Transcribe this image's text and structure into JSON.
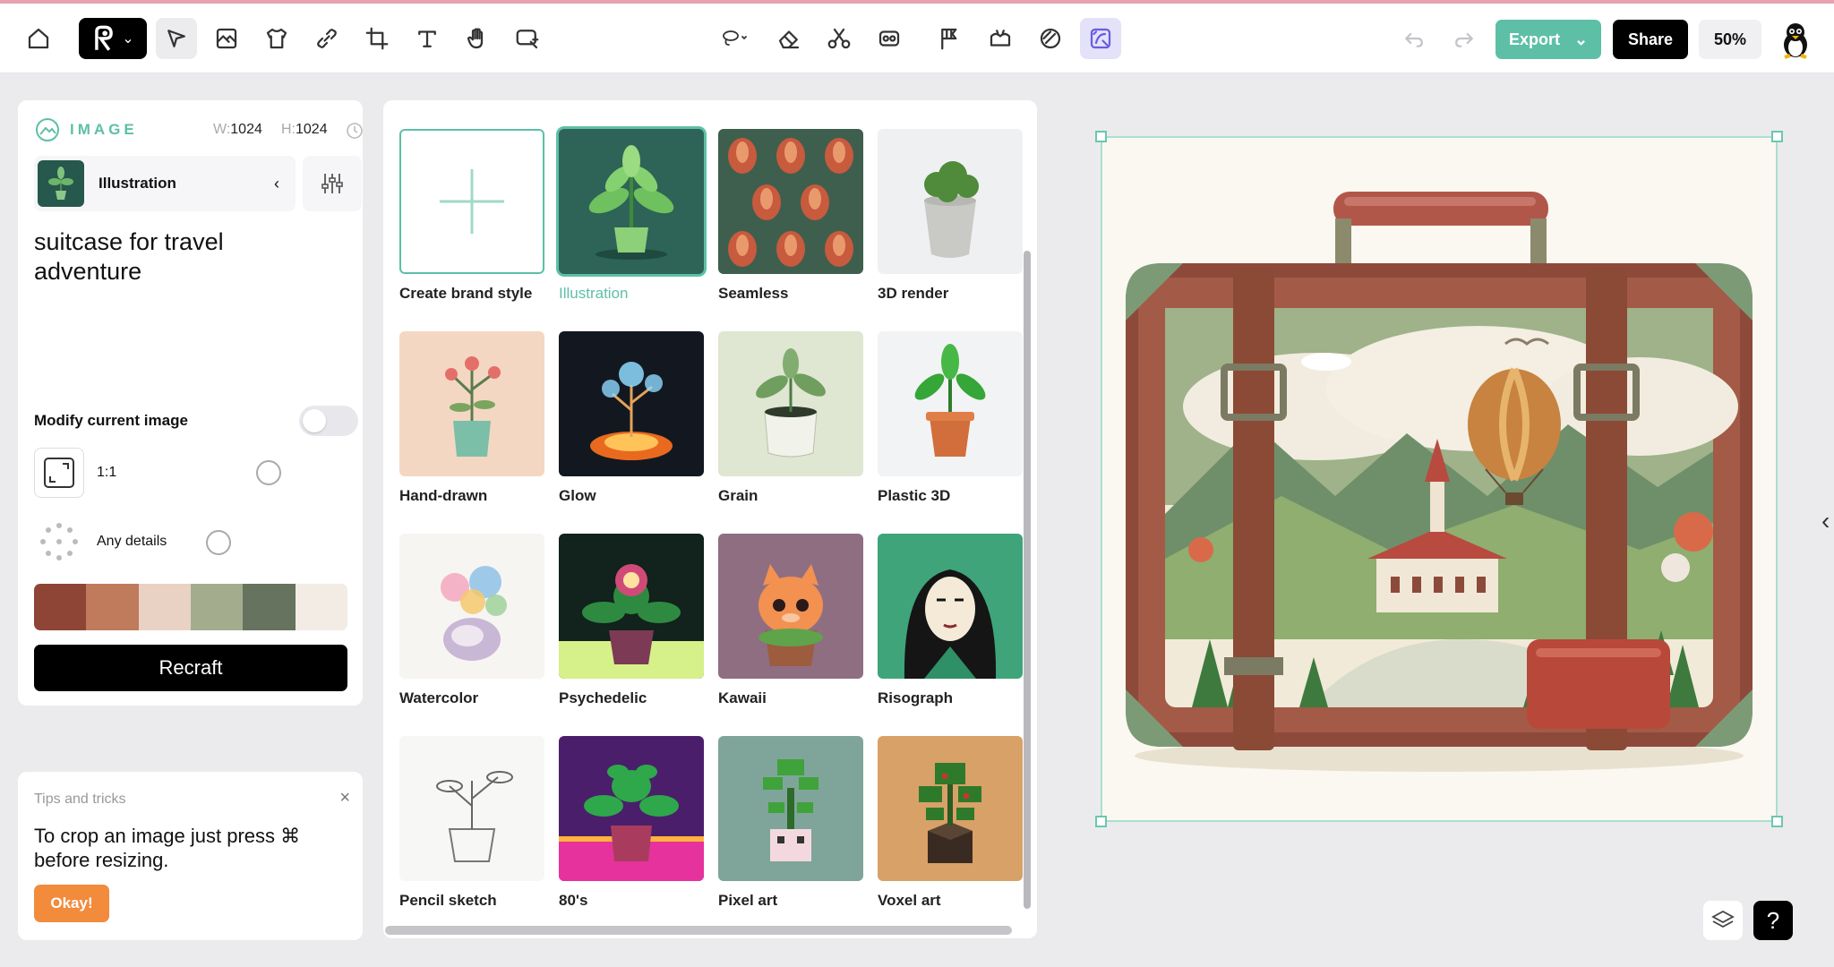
{
  "toolbar": {
    "tools": [
      {
        "name": "home-icon"
      },
      {
        "name": "select-icon"
      },
      {
        "name": "frame-icon"
      },
      {
        "name": "mockup-icon"
      },
      {
        "name": "link-icon"
      },
      {
        "name": "crop-icon"
      },
      {
        "name": "text-icon"
      },
      {
        "name": "hand-icon"
      },
      {
        "name": "comment-icon"
      },
      {
        "name": "lasso-icon"
      },
      {
        "name": "eraser-icon"
      },
      {
        "name": "scissors-icon"
      },
      {
        "name": "inpaint-icon"
      },
      {
        "name": "flag-icon"
      },
      {
        "name": "vectorize-icon"
      },
      {
        "name": "brush-icon"
      },
      {
        "name": "ai-remove-icon"
      }
    ],
    "export_label": "Export",
    "share_label": "Share",
    "zoom": "50%"
  },
  "image_panel": {
    "label": "IMAGE",
    "width_label": "W:",
    "width_value": "1024",
    "height_label": "H:",
    "height_value": "1024",
    "style_name": "Illustration",
    "prompt": "suitcase for travel adventure",
    "modify_label": "Modify current image",
    "ratio_label": "1:1",
    "details_label": "Any details",
    "palette": [
      "#8f4535",
      "#c07a5c",
      "#e9d2c3",
      "#a3ad8d",
      "#65735f",
      "#f3ece4"
    ],
    "recraft_label": "Recraft"
  },
  "tips": {
    "title": "Tips and tricks",
    "text": "To crop an image just press ⌘ before resizing.",
    "okay_label": "Okay!"
  },
  "styles": [
    {
      "label": "Create brand style"
    },
    {
      "label": "Illustration"
    },
    {
      "label": "Seamless"
    },
    {
      "label": "3D render"
    },
    {
      "label": "Hand-drawn"
    },
    {
      "label": "Glow"
    },
    {
      "label": "Grain"
    },
    {
      "label": "Plastic 3D"
    },
    {
      "label": "Watercolor"
    },
    {
      "label": "Psychedelic"
    },
    {
      "label": "Kawaii"
    },
    {
      "label": "Risograph"
    },
    {
      "label": "Pencil sketch"
    },
    {
      "label": "80's"
    },
    {
      "label": "Pixel art"
    },
    {
      "label": "Voxel art"
    }
  ],
  "help_label": "?"
}
